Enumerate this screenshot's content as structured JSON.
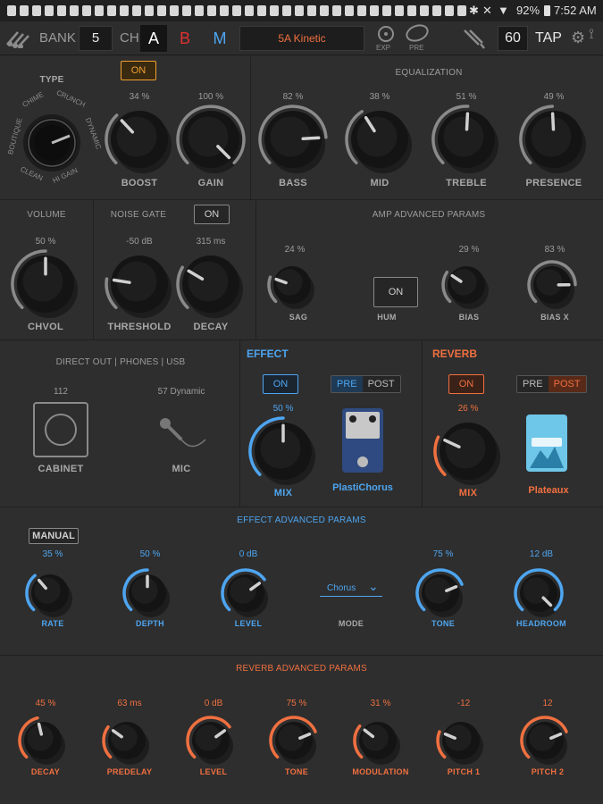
{
  "status_bar": {
    "battery": "92%",
    "time": "7:52 AM"
  },
  "toolbar": {
    "bank_label": "BANK",
    "bank_value": "5",
    "ch_label": "CH",
    "channels": [
      "A",
      "B",
      "M"
    ],
    "preset_name": "5A Kinetic",
    "exp_label": "EXP",
    "pre_label": "PRE",
    "tempo": "60",
    "tap_label": "TAP"
  },
  "amp": {
    "type_label": "TYPE",
    "type_options": [
      "CHIME",
      "CRUNCH",
      "DYNAMIC",
      "HI GAIN",
      "CLEAN",
      "BOUTIQUE"
    ],
    "boost_on_label": "ON",
    "boost": {
      "value": "34 %",
      "label": "BOOST"
    },
    "gain": {
      "value": "100 %",
      "label": "GAIN"
    }
  },
  "eq": {
    "title": "EQUALIZATION",
    "bass": {
      "value": "82 %",
      "label": "BASS"
    },
    "mid": {
      "value": "38 %",
      "label": "MID"
    },
    "treble": {
      "value": "51 %",
      "label": "TREBLE"
    },
    "presence": {
      "value": "49 %",
      "label": "PRESENCE"
    }
  },
  "volume": {
    "title": "VOLUME",
    "value": "50 %",
    "label": "CHVOL"
  },
  "noise_gate": {
    "title": "NOISE GATE",
    "on_label": "ON",
    "threshold": {
      "value": "-50 dB",
      "label": "THRESHOLD"
    },
    "decay": {
      "value": "315 ms",
      "label": "DECAY"
    }
  },
  "amp_adv": {
    "title": "AMP ADVANCED PARAMS",
    "sag": {
      "value": "24 %",
      "label": "SAG"
    },
    "hum": {
      "on_label": "ON",
      "label": "HUM"
    },
    "bias": {
      "value": "29 %",
      "label": "BIAS"
    },
    "bias_x": {
      "value": "83 %",
      "label": "BIAS X"
    }
  },
  "direct_out": {
    "title": "DIRECT OUT | PHONES | USB",
    "cabinet_value": "112",
    "cabinet_label": "CABINET",
    "mic_value": "57 Dynamic",
    "mic_label": "MIC"
  },
  "effect": {
    "title": "EFFECT",
    "on_label": "ON",
    "pre_label": "PRE",
    "post_label": "POST",
    "mix": {
      "value": "50 %",
      "label": "MIX"
    },
    "pedal_name": "PlastiChorus"
  },
  "reverb": {
    "title": "REVERB",
    "on_label": "ON",
    "pre_label": "PRE",
    "post_label": "POST",
    "mix": {
      "value": "26 %",
      "label": "MIX"
    },
    "pedal_name": "Plateaux"
  },
  "effect_adv": {
    "title": "EFFECT ADVANCED PARAMS",
    "manual_label": "MANUAL",
    "rate": {
      "value": "35 %",
      "label": "RATE"
    },
    "depth": {
      "value": "50 %",
      "label": "DEPTH"
    },
    "level": {
      "value": "0 dB",
      "label": "LEVEL"
    },
    "mode": {
      "value": "Chorus",
      "label": "MODE"
    },
    "tone": {
      "value": "75 %",
      "label": "TONE"
    },
    "headroom": {
      "value": "12 dB",
      "label": "HEADROOM"
    }
  },
  "reverb_adv": {
    "title": "REVERB ADVANCED PARAMS",
    "decay": {
      "value": "45 %",
      "label": "DECAY"
    },
    "predelay": {
      "value": "63 ms",
      "label": "PREDELAY"
    },
    "level": {
      "value": "0 dB",
      "label": "LEVEL"
    },
    "tone": {
      "value": "75 %",
      "label": "TONE"
    },
    "modulation": {
      "value": "31 %",
      "label": "MODULATION"
    },
    "pitch1": {
      "value": "-12",
      "label": "PITCH 1"
    },
    "pitch2": {
      "value": "12",
      "label": "PITCH 2"
    }
  },
  "colors": {
    "accent_blue": "#4ea5f0",
    "accent_orange": "#f07040",
    "boost_on": "#f0a030",
    "ch_b": "#e03030",
    "ch_m": "#4ea5f0"
  }
}
